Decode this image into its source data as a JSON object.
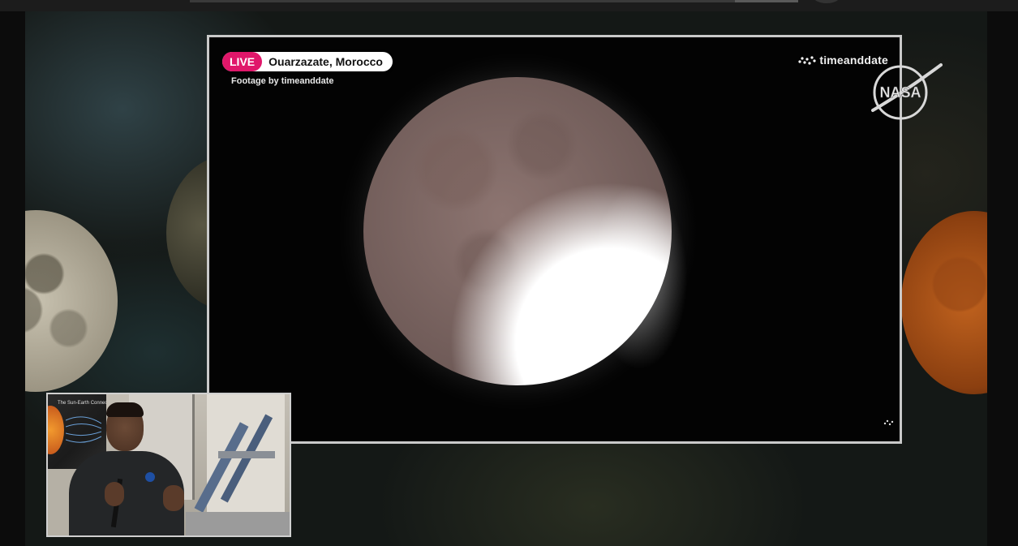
{
  "stream": {
    "live_label": "LIVE",
    "location": "Ouarzazate, Morocco",
    "footage_credit": "Footage by timeanddate",
    "brand_logo_text": "timeanddate",
    "nasa_logo_text": "NASA"
  },
  "pip": {
    "poster_title": "The Sun-Earth Connection"
  },
  "colors": {
    "live_accent": "#e0176a",
    "frame_border": "#c9c9c9"
  },
  "icons": {
    "brand": "timeanddate-dots-icon",
    "agency": "nasa-logo-icon"
  }
}
